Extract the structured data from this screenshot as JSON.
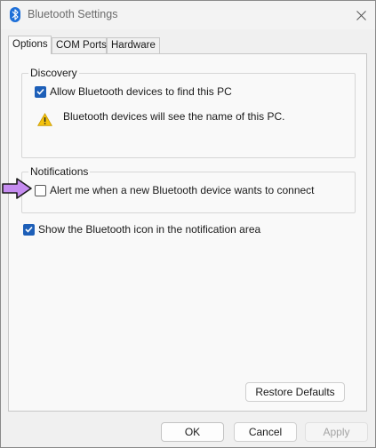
{
  "window": {
    "title": "Bluetooth Settings",
    "icon": "bluetooth-icon",
    "close_icon": "close-icon"
  },
  "tabs": [
    {
      "label": "Options",
      "active": true
    },
    {
      "label": "COM Ports",
      "active": false
    },
    {
      "label": "Hardware",
      "active": false
    }
  ],
  "discovery": {
    "legend": "Discovery",
    "allow_label": "Allow Bluetooth devices to find this PC",
    "allow_checked": true,
    "warning_text": "Bluetooth devices will see the name of this PC.",
    "warning_icon": "warning-icon"
  },
  "notifications": {
    "legend": "Notifications",
    "alert_label": "Alert me when a new Bluetooth device wants to connect",
    "alert_checked": false
  },
  "show_icon": {
    "label": "Show the Bluetooth icon in the notification area",
    "checked": true
  },
  "buttons": {
    "restore_defaults": "Restore Defaults",
    "ok": "OK",
    "cancel": "Cancel",
    "apply": "Apply"
  },
  "colors": {
    "accent": "#1d5fb8",
    "pointer": "#c58cf0"
  }
}
